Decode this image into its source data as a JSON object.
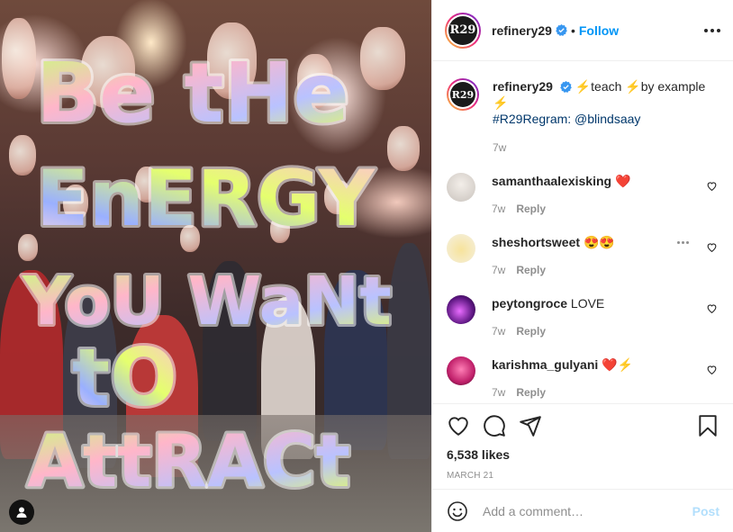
{
  "media": {
    "overlay_lines": [
      "Be tHe",
      "EnERGY",
      "YoU WaNt",
      "tO",
      "AttRACt"
    ],
    "tag_icon": "user-tag-icon"
  },
  "header": {
    "username": "refinery29",
    "verified_icon": "verified-badge-icon",
    "separator": "•",
    "follow_label": "Follow",
    "more_icon": "more-options-icon",
    "avatar_text": "R29"
  },
  "caption": {
    "username": "refinery29",
    "text_part1": "⚡teach ⚡by example ⚡",
    "hashtag": "#R29Regram",
    "text_part2": ": @blindsaay",
    "time": "7w"
  },
  "comments": [
    {
      "username": "samanthaalexisking",
      "text": "❤️",
      "time": "7w",
      "reply_label": "Reply"
    },
    {
      "username": "sheshortsweet",
      "text": "😍😍",
      "time": "7w",
      "reply_label": "Reply"
    },
    {
      "username": "peytongroce",
      "text": "LOVE",
      "time": "7w",
      "reply_label": "Reply"
    },
    {
      "username": "karishma_gulyani",
      "text": "❤️⚡",
      "time": "7w",
      "reply_label": "Reply"
    }
  ],
  "actions": {
    "like_icon": "heart-icon",
    "comment_icon": "comment-icon",
    "share_icon": "share-icon",
    "save_icon": "bookmark-icon"
  },
  "likes_text": "6,538 likes",
  "date_text": "MARCH 21",
  "add_comment": {
    "emoji_icon": "emoji-icon",
    "placeholder": "Add a comment…",
    "post_label": "Post"
  },
  "colors": {
    "link_blue": "#0095f6",
    "hashtag_blue": "#00376b",
    "muted_gray": "#8e8e8e",
    "post_disabled": "#b2dffc"
  }
}
